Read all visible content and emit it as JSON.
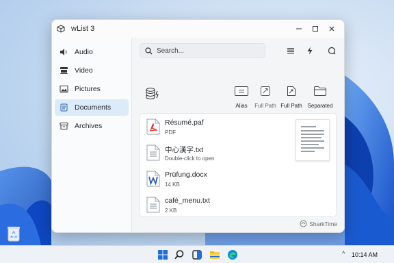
{
  "window": {
    "title": "wList 3"
  },
  "sidebar": {
    "items": [
      {
        "label": "Audio",
        "icon": "speaker-icon"
      },
      {
        "label": "Video",
        "icon": "film-icon"
      },
      {
        "label": "Pictures",
        "icon": "image-icon"
      },
      {
        "label": "Documents",
        "icon": "document-icon",
        "active": true
      },
      {
        "label": "Archives",
        "icon": "archive-icon"
      }
    ]
  },
  "search": {
    "placeholder": "Search..."
  },
  "toolbar": {
    "icons": [
      "list-icon",
      "lightning-icon",
      "refresh-icon"
    ]
  },
  "path_buttons": [
    {
      "label": "Alias",
      "icon": "alias-icon"
    },
    {
      "label": "Full Path",
      "icon": "full-path-icon",
      "muted": true
    },
    {
      "label": "Full Path",
      "icon": "full-path-doc-icon"
    },
    {
      "label": "Separated",
      "icon": "folder-icon"
    }
  ],
  "files": [
    {
      "name": "Résumé.paf",
      "meta": "PDF",
      "icon": "pdf-file-icon"
    },
    {
      "name": "中心漢字.txt",
      "meta": "Double-click to open",
      "icon": "text-file-icon"
    },
    {
      "name": "Prüfung.docx",
      "meta": "14 KB",
      "icon": "word-file-icon"
    },
    {
      "name": "café_menu.txt",
      "meta": "2 KB",
      "icon": "text-file-icon"
    }
  ],
  "brand": {
    "name": "SharkTime"
  },
  "taskbar": {
    "icons": [
      "windows-start-icon",
      "search-icon",
      "task-view-icon",
      "file-explorer-icon",
      "edge-browser-icon"
    ],
    "tray_chevron": "^",
    "clock": "10:14 AM"
  },
  "colors": {
    "accent": "#1f6fd6",
    "active_nav": "#dcebf9",
    "pdf": "#d93025",
    "word": "#2b5cb8"
  }
}
